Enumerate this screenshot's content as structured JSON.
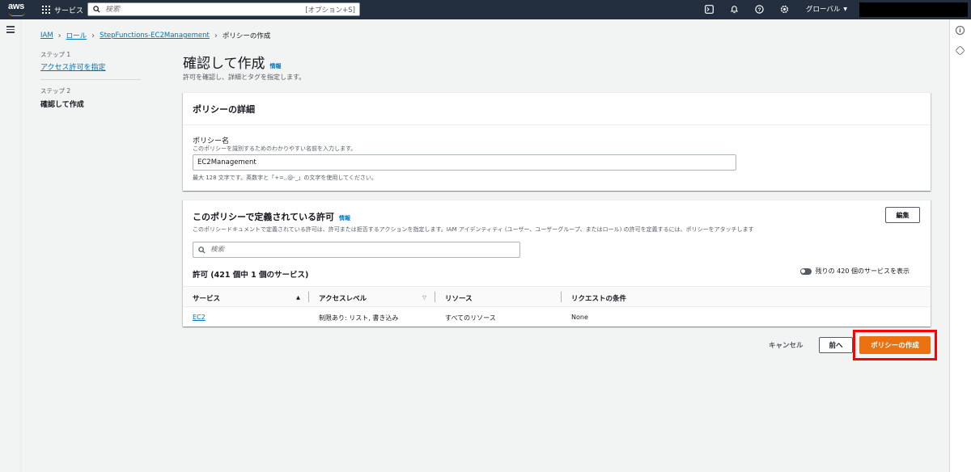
{
  "topbar": {
    "logo_text": "aws",
    "services_label": "サービス",
    "search_placeholder": "検索",
    "search_shortcut": "[オプション+S]",
    "region_label": "グローバル",
    "icons": [
      "terminal-icon",
      "bell-icon",
      "help-icon",
      "settings-icon"
    ]
  },
  "breadcrumb": {
    "items": [
      "IAM",
      "ロール",
      "StepFunctions-EC2Management"
    ],
    "current": "ポリシーの作成"
  },
  "steps": [
    {
      "label": "ステップ 1",
      "title": "アクセス許可を指定"
    },
    {
      "label": "ステップ 2",
      "title": "確認して作成"
    }
  ],
  "page": {
    "title": "確認して作成",
    "info": "情報",
    "description": "許可を確認し、詳細とタグを指定します。"
  },
  "policy_details": {
    "heading": "ポリシーの詳細",
    "name_label": "ポリシー名",
    "name_description": "このポリシーを識別するためのわかりやすい名前を入力します。",
    "name_value": "EC2Management",
    "name_hint": "最大 128 文字です。英数字と「+=,.@-_」の文字を使用してください。"
  },
  "permissions": {
    "heading": "このポリシーで定義されている許可",
    "info": "情報",
    "description": "このポリシードキュメントで定義されている許可は、許可または拒否するアクションを指定します。IAM アイデンティティ (ユーザー、ユーザーグループ、またはロール) の許可を定義するには、ポリシーをアタッチします",
    "edit_label": "編集",
    "search_placeholder": "検索",
    "count_label": "許可 (421 個中 1 個のサービス)",
    "toggle_label": "残りの 420 個のサービスを表示",
    "toggle_on": false,
    "columns": [
      "サービス",
      "アクセスレベル",
      "リソース",
      "リクエストの条件"
    ],
    "rows": [
      {
        "service": "EC2",
        "access": "制限あり: リスト, 書き込み",
        "resource": "すべてのリソース",
        "condition": "None"
      }
    ]
  },
  "footer": {
    "cancel": "キャンセル",
    "previous": "前へ",
    "create": "ポリシーの作成"
  },
  "colors": {
    "topbar": "#232f3e",
    "primary_button": "#ec7211",
    "link": "#0073bb",
    "highlight": "#ff0000"
  }
}
